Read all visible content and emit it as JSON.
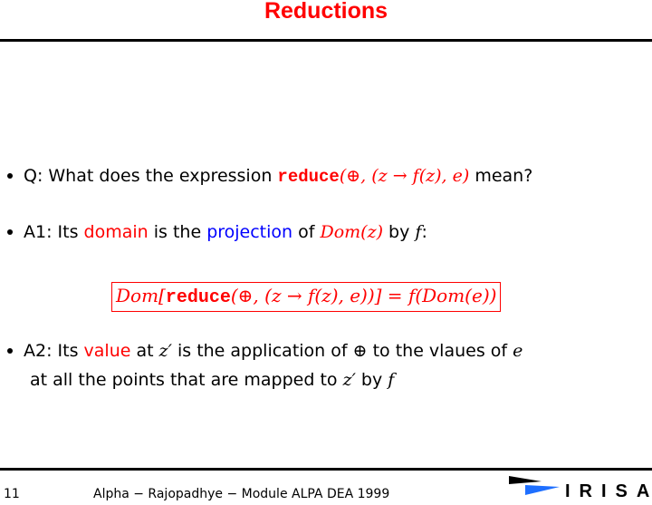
{
  "slide": {
    "title": "Reductions",
    "page_number": "11",
    "footer_text": "Alpha − Rajopadhye − Module ALPA DEA 1999",
    "logo_text": "IRISA",
    "colors": {
      "title": "#ff0000",
      "highlight_red": "#ff0000",
      "highlight_blue": "#0000ff"
    }
  },
  "bullets": {
    "q": {
      "prefix": "Q: What does the expression ",
      "expr_kw": "reduce",
      "expr_args": "(⊕, (z → f(z), e)",
      "suffix": " mean?"
    },
    "a1": {
      "prefix": "A1: Its ",
      "domain": "domain",
      "mid1": " is the ",
      "projection": "projection",
      "mid2": " of ",
      "dom_z": "Dom(z)",
      "mid3": " by ",
      "f": "f",
      "suffix": ":"
    },
    "boxed_eq": {
      "dom": "Dom[",
      "kw": "reduce",
      "args": "(⊕, (z → f(z), e))]",
      "eq": " = ",
      "rhs": "f(Dom(e))"
    },
    "a2": {
      "prefix": "A2: Its ",
      "value": "value",
      "mid1": " at ",
      "zprime": "z′",
      "mid2": " is the application of ",
      "oplus": "⊕",
      "mid3": " to the vlaues of ",
      "e": "e",
      "line2_prefix": "at all the points that are mapped to ",
      "zprime2": "z′",
      "line2_mid": " by ",
      "f": "f"
    }
  }
}
